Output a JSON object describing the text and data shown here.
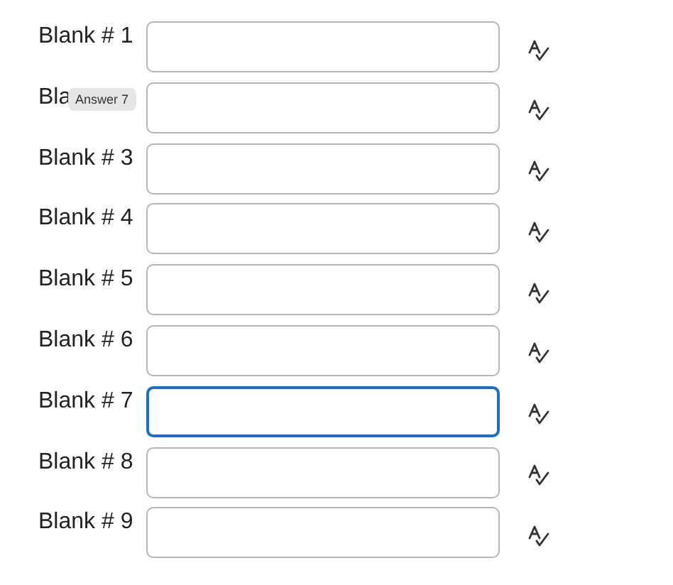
{
  "blanks": [
    {
      "label": "Blank # 1",
      "focused": false
    },
    {
      "label": "Bla",
      "focused": false,
      "tooltip": "Answer 7"
    },
    {
      "label": "Blank # 3",
      "focused": false
    },
    {
      "label": "Blank # 4",
      "focused": false
    },
    {
      "label": "Blank # 5",
      "focused": false
    },
    {
      "label": "Blank # 6",
      "focused": false
    },
    {
      "label": "Blank # 7",
      "focused": true
    },
    {
      "label": "Blank # 8",
      "focused": false
    },
    {
      "label": "Blank # 9",
      "focused": false
    }
  ]
}
